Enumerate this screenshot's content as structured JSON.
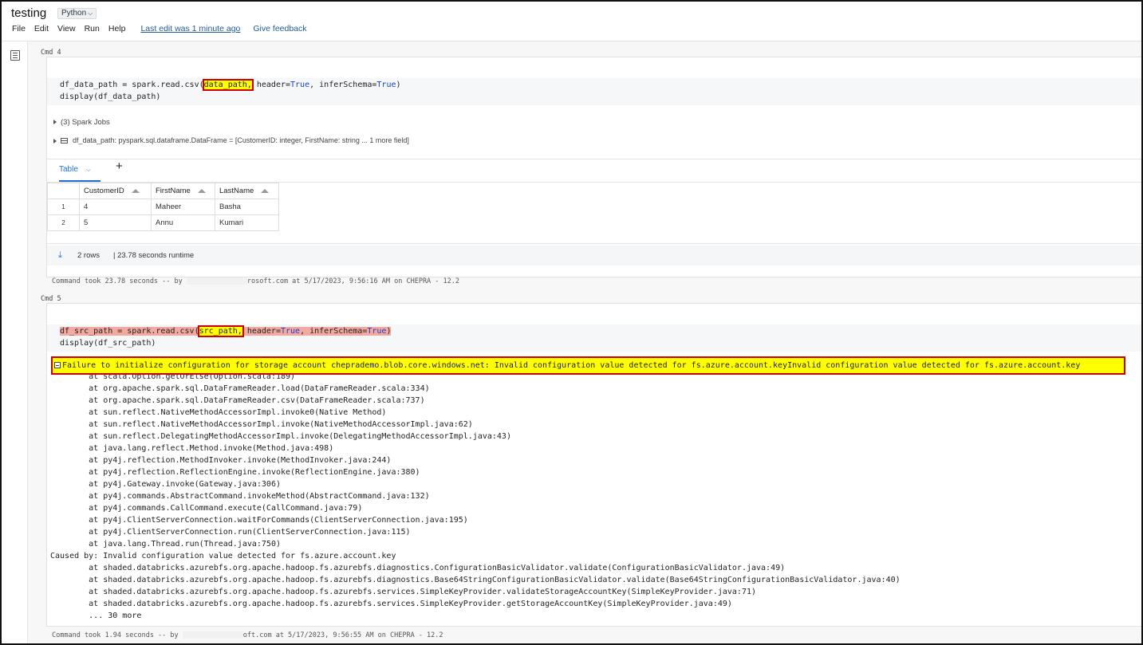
{
  "header": {
    "title": "testing",
    "language": "Python",
    "menu": [
      "File",
      "Edit",
      "View",
      "Run",
      "Help"
    ],
    "last_edit": "Last edit was 1 minute ago",
    "feedback": "Give feedback"
  },
  "cmd4": {
    "label": "Cmd 4",
    "code": {
      "l1_pre": "df_data_path = spark.read.csv(",
      "l1_arg": "data_path,",
      "l1_mid": " header=",
      "l1_true1": "True",
      "l1_mid2": ", inferSchema=",
      "l1_true2": "True",
      "l1_end": ")",
      "l2": "display(df_data_path)"
    },
    "spark_jobs": "(3) Spark Jobs",
    "df_schema": "df_data_path:  pyspark.sql.dataframe.DataFrame = [CustomerID: integer, FirstName: string ... 1 more field]",
    "tab_label": "Table",
    "add_tab": "+",
    "table": {
      "columns": [
        "CustomerID",
        "FirstName",
        "LastName"
      ],
      "rows": [
        {
          "n": "1",
          "cells": [
            "4",
            "Maheer",
            "Basha"
          ]
        },
        {
          "n": "2",
          "cells": [
            "5",
            "Annu",
            "Kumari"
          ]
        }
      ]
    },
    "rows_count": "2 rows",
    "runtime": "|  23.78 seconds runtime",
    "took_pre": "Command took 23.78 seconds -- by",
    "took_post": "rosoft.com at 5/17/2023, 9:56:16 AM on CHEPRA - 12.2"
  },
  "cmd5": {
    "label": "Cmd 5",
    "code": {
      "l1_pre": "df_src_path = spark.read.csv(",
      "l1_arg": "src_path,",
      "l1_mid": " header=",
      "l1_true1": "True",
      "l1_mid2": ", inferSchema=",
      "l1_true2": "True",
      "l1_end": ")",
      "l2": "display(df_src_path)"
    },
    "error": "Failure to initialize configuration for storage account cheprademo.blob.core.windows.net: Invalid configuration value detected for fs.azure.account.keyInvalid configuration value detected for fs.azure.account.key",
    "trace": [
      "        at scala.Option.getOrElse(Option.scala:189)",
      "        at org.apache.spark.sql.DataFrameReader.load(DataFrameReader.scala:334)",
      "        at org.apache.spark.sql.DataFrameReader.csv(DataFrameReader.scala:737)",
      "        at sun.reflect.NativeMethodAccessorImpl.invoke0(Native Method)",
      "        at sun.reflect.NativeMethodAccessorImpl.invoke(NativeMethodAccessorImpl.java:62)",
      "        at sun.reflect.DelegatingMethodAccessorImpl.invoke(DelegatingMethodAccessorImpl.java:43)",
      "        at java.lang.reflect.Method.invoke(Method.java:498)",
      "        at py4j.reflection.MethodInvoker.invoke(MethodInvoker.java:244)",
      "        at py4j.reflection.ReflectionEngine.invoke(ReflectionEngine.java:380)",
      "        at py4j.Gateway.invoke(Gateway.java:306)",
      "        at py4j.commands.AbstractCommand.invokeMethod(AbstractCommand.java:132)",
      "        at py4j.commands.CallCommand.execute(CallCommand.java:79)",
      "        at py4j.ClientServerConnection.waitForCommands(ClientServerConnection.java:195)",
      "        at py4j.ClientServerConnection.run(ClientServerConnection.java:115)",
      "        at java.lang.Thread.run(Thread.java:750)",
      "Caused by: Invalid configuration value detected for fs.azure.account.key",
      "        at shaded.databricks.azurebfs.org.apache.hadoop.fs.azurebfs.diagnostics.ConfigurationBasicValidator.validate(ConfigurationBasicValidator.java:49)",
      "        at shaded.databricks.azurebfs.org.apache.hadoop.fs.azurebfs.diagnostics.Base64StringConfigurationBasicValidator.validate(Base64StringConfigurationBasicValidator.java:40)",
      "        at shaded.databricks.azurebfs.org.apache.hadoop.fs.azurebfs.services.SimpleKeyProvider.validateStorageAccountKey(SimpleKeyProvider.java:71)",
      "        at shaded.databricks.azurebfs.org.apache.hadoop.fs.azurebfs.services.SimpleKeyProvider.getStorageAccountKey(SimpleKeyProvider.java:49)",
      "        ... 30 more"
    ],
    "took_pre": "Command took 1.94 seconds -- by",
    "took_post": "oft.com at 5/17/2023, 9:56:55 AM on CHEPRA - 12.2"
  }
}
